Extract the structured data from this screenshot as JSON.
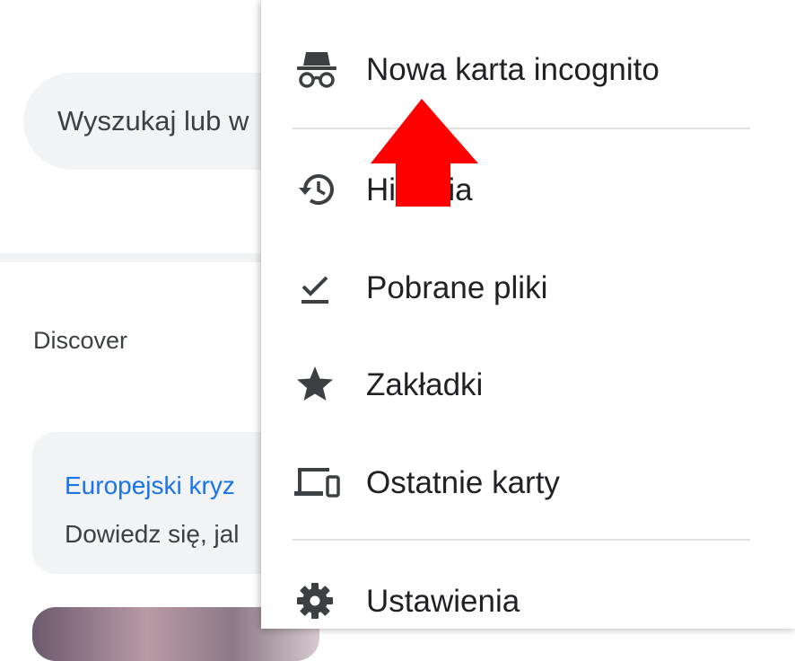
{
  "search": {
    "placeholder_text": "Wyszukaj lub w"
  },
  "discover": {
    "label": "Discover"
  },
  "feed_card": {
    "title": "Europejski kryz",
    "description": "Dowiedz się, jal"
  },
  "menu": {
    "items": [
      {
        "label": "Nowa karta incognito",
        "icon": "incognito-icon"
      },
      {
        "label": "Historia",
        "icon": "history-icon"
      },
      {
        "label": "Pobrane pliki",
        "icon": "download-done-icon"
      },
      {
        "label": "Zakładki",
        "icon": "star-icon"
      },
      {
        "label": "Ostatnie karty",
        "icon": "devices-icon"
      },
      {
        "label": "Ustawienia",
        "icon": "gear-icon"
      }
    ]
  },
  "colors": {
    "link": "#1a73e8",
    "annotation": "#ff0000",
    "surface": "#f1f3f4"
  }
}
